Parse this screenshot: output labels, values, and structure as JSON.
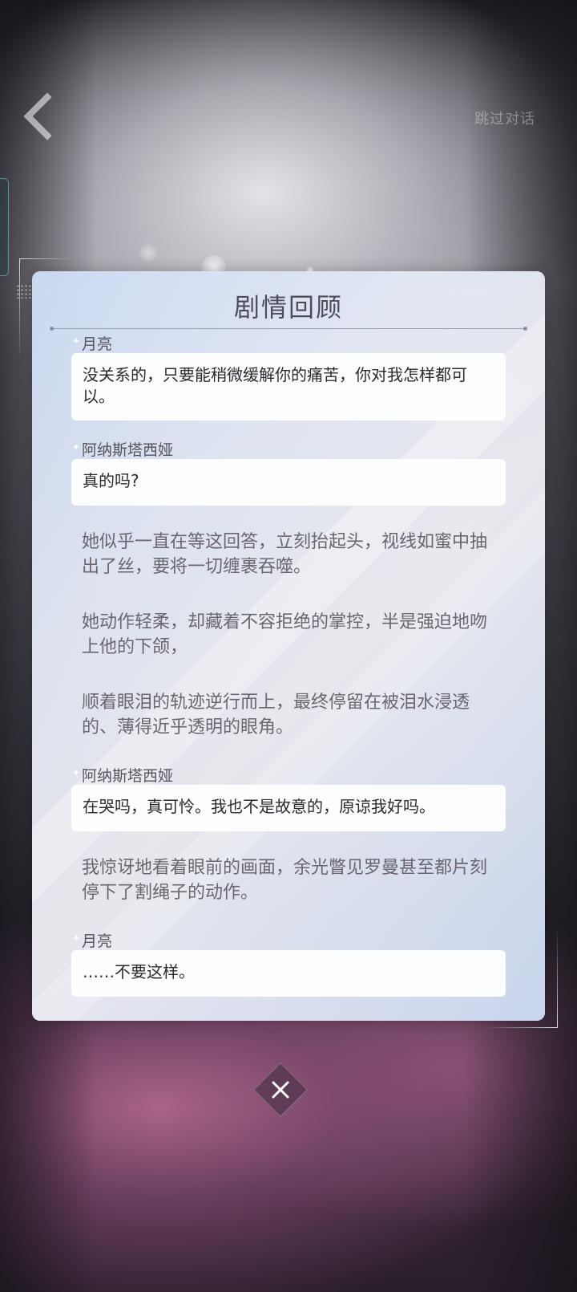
{
  "header": {
    "back_icon": "chevron-left-icon",
    "top_right_label": "跳过对话"
  },
  "panel": {
    "title": "剧情回顾",
    "entries": [
      {
        "type": "dialogue",
        "speaker": "月亮",
        "text": "没关系的，只要能稍微缓解你的痛苦，你对我怎样都可以。"
      },
      {
        "type": "dialogue",
        "speaker": "阿纳斯塔西娅",
        "text": "真的吗?"
      },
      {
        "type": "narration",
        "text": "她似乎一直在等这回答，立刻抬起头，视线如蜜中抽出了丝，要将一切缠裹吞噬。"
      },
      {
        "type": "narration",
        "text": "她动作轻柔，却藏着不容拒绝的掌控，半是强迫地吻上他的下颌，"
      },
      {
        "type": "narration",
        "text": "顺着眼泪的轨迹逆行而上，最终停留在被泪水浸透的、薄得近乎透明的眼角。"
      },
      {
        "type": "dialogue",
        "speaker": "阿纳斯塔西娅",
        "text": "在哭吗，真可怜。我也不是故意的，原谅我好吗。"
      },
      {
        "type": "narration",
        "text": "我惊讶地看着眼前的画面，余光瞥见罗曼甚至都片刻停下了割绳子的动作。"
      },
      {
        "type": "dialogue",
        "speaker": "月亮",
        "text": "……不要这样。"
      }
    ]
  },
  "close_button": {
    "icon": "close-icon"
  },
  "colors": {
    "panel_bg": "#e2e8f4",
    "bubble_bg": "#ffffff",
    "title_text": "#4e4c58",
    "narration_text": "#6a6670"
  }
}
